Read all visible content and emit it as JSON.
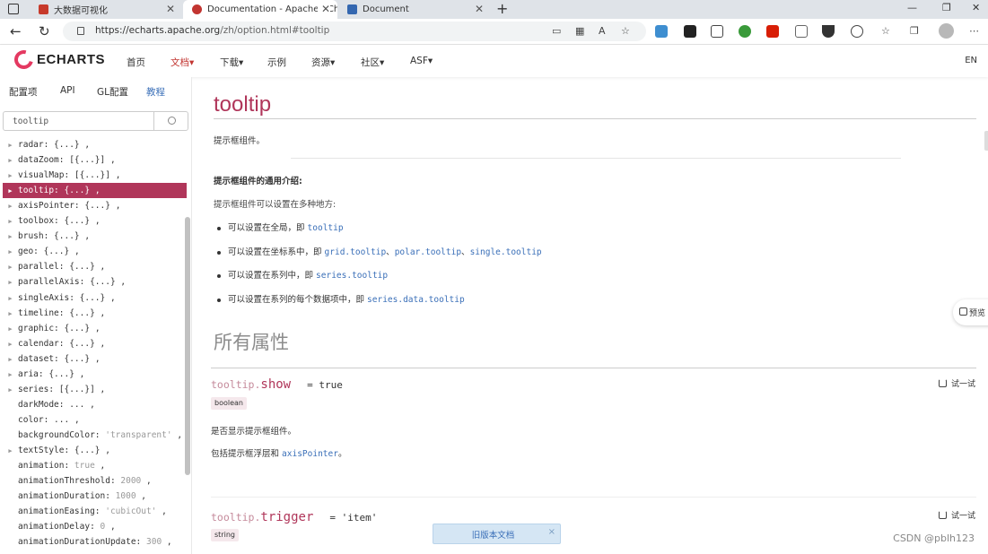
{
  "browser": {
    "tabs": [
      {
        "title": "大数据可视化",
        "active": false,
        "favicon_color": "#c73a2b"
      },
      {
        "title": "Documentation - Apache EChart",
        "active": true,
        "favicon_color": "#c23531"
      },
      {
        "title": "Document",
        "active": false,
        "favicon_color": "#3467b0"
      }
    ],
    "url_host": "https://echarts.apache.org",
    "url_path": "/zh/option.html#tooltip"
  },
  "header": {
    "logo_text": "ECHARTS",
    "menu": [
      {
        "label": "首页",
        "active": false
      },
      {
        "label": "文档▾",
        "active": true
      },
      {
        "label": "下载▾",
        "active": false
      },
      {
        "label": "示例",
        "active": false
      },
      {
        "label": "资源▾",
        "active": false
      },
      {
        "label": "社区▾",
        "active": false
      },
      {
        "label": "ASF▾",
        "active": false
      }
    ],
    "lang": "EN"
  },
  "sidebar": {
    "tabs": [
      {
        "label": "配置项",
        "link": false
      },
      {
        "label": "API",
        "link": false
      },
      {
        "label": "GL配置",
        "link": false
      },
      {
        "label": "教程",
        "link": true
      }
    ],
    "search_value": "tooltip",
    "tree": [
      {
        "key": "radar",
        "value": "{...}",
        "expandable": true
      },
      {
        "key": "dataZoom",
        "value": "[{...}]",
        "expandable": true
      },
      {
        "key": "visualMap",
        "value": "[{...}]",
        "expandable": true
      },
      {
        "key": "tooltip",
        "value": "{...}",
        "expandable": true,
        "selected": true
      },
      {
        "key": "axisPointer",
        "value": "{...}",
        "expandable": true
      },
      {
        "key": "toolbox",
        "value": "{...}",
        "expandable": true
      },
      {
        "key": "brush",
        "value": "{...}",
        "expandable": true
      },
      {
        "key": "geo",
        "value": "{...}",
        "expandable": true
      },
      {
        "key": "parallel",
        "value": "{...}",
        "expandable": true
      },
      {
        "key": "parallelAxis",
        "value": "{...}",
        "expandable": true
      },
      {
        "key": "singleAxis",
        "value": "{...}",
        "expandable": true
      },
      {
        "key": "timeline",
        "value": "{...}",
        "expandable": true
      },
      {
        "key": "graphic",
        "value": "{...}",
        "expandable": true
      },
      {
        "key": "calendar",
        "value": "{...}",
        "expandable": true
      },
      {
        "key": "dataset",
        "value": "{...}",
        "expandable": true
      },
      {
        "key": "aria",
        "value": "{...}",
        "expandable": true
      },
      {
        "key": "series",
        "value": "[{...}]",
        "expandable": true
      },
      {
        "key": "darkMode",
        "value": "...",
        "expandable": false
      },
      {
        "key": "color",
        "value": "...",
        "expandable": false
      },
      {
        "key": "backgroundColor",
        "value": "'transparent'",
        "expandable": false,
        "dim": true
      },
      {
        "key": "textStyle",
        "value": "{...}",
        "expandable": true
      },
      {
        "key": "animation",
        "value": "true",
        "expandable": false,
        "dim": true
      },
      {
        "key": "animationThreshold",
        "value": "2000",
        "expandable": false,
        "dim": true
      },
      {
        "key": "animationDuration",
        "value": "1000",
        "expandable": false,
        "dim": true
      },
      {
        "key": "animationEasing",
        "value": "'cubicOut'",
        "expandable": false,
        "dim": true
      },
      {
        "key": "animationDelay",
        "value": "0",
        "expandable": false,
        "dim": true
      },
      {
        "key": "animationDurationUpdate",
        "value": "300",
        "expandable": false,
        "dim": true
      }
    ]
  },
  "content": {
    "title": "tooltip",
    "description": "提示框组件。",
    "intro_heading": "提示框组件的通用介绍:",
    "intro_text": "提示框组件可以设置在多种地方:",
    "bullets": [
      {
        "text": "可以设置在全局，即 ",
        "codes": [
          "tooltip"
        ]
      },
      {
        "text": "可以设置在坐标系中，即 ",
        "codes": [
          "grid.tooltip",
          "polar.tooltip",
          "single.tooltip"
        ]
      },
      {
        "text": "可以设置在系列中，即 ",
        "codes": [
          "series.tooltip"
        ]
      },
      {
        "text": "可以设置在系列的每个数据项中，即 ",
        "codes": [
          "series.data.tooltip"
        ]
      }
    ],
    "code_separator": "、",
    "section_title": "所有属性",
    "properties": [
      {
        "prefix": "tooltip.",
        "name": "show",
        "default": "= true",
        "type": "boolean",
        "desc": "是否显示提示框组件。",
        "desc2_text": "包括提示框浮层和 ",
        "desc2_code": "axisPointer",
        "desc2_end": "。",
        "try_label": "试一试"
      },
      {
        "prefix": "tooltip.",
        "name": "trigger",
        "default": "= 'item'",
        "type": "string",
        "try_label": "试一试"
      }
    ]
  },
  "overlays": {
    "old_docs": "旧版本文档",
    "old_docs_close": "×",
    "preview": "预览",
    "watermark": "CSDN @pblh123"
  }
}
